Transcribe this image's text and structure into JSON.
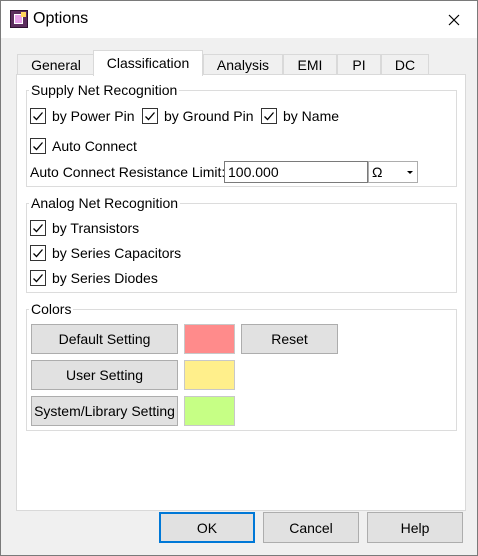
{
  "window": {
    "title": "Options"
  },
  "tabs": [
    {
      "label": "General",
      "active": false
    },
    {
      "label": "Classification",
      "active": true
    },
    {
      "label": "Analysis",
      "active": false
    },
    {
      "label": "EMI",
      "active": false
    },
    {
      "label": "PI",
      "active": false
    },
    {
      "label": "DC",
      "active": false
    }
  ],
  "supply": {
    "title": "Supply Net Recognition",
    "power_pin": {
      "label": "by Power Pin",
      "checked": true
    },
    "ground_pin": {
      "label": "by Ground Pin",
      "checked": true
    },
    "by_name": {
      "label": "by Name",
      "checked": true
    },
    "auto_connect": {
      "label": "Auto Connect",
      "checked": true
    },
    "limit_label": "Auto Connect Resistance Limit:",
    "limit_value": "100.000",
    "unit": "Ω"
  },
  "analog": {
    "title": "Analog Net Recognition",
    "transistors": {
      "label": "by Transistors",
      "checked": true
    },
    "capacitors": {
      "label": "by Series Capacitors",
      "checked": true
    },
    "diodes": {
      "label": "by Series Diodes",
      "checked": true
    }
  },
  "colors": {
    "title": "Colors",
    "default_label": "Default Setting",
    "default_color": "#ff8b8b",
    "reset_label": "Reset",
    "user_label": "User Setting",
    "user_color": "#ffef8b",
    "system_label": "System/Library Setting",
    "system_color": "#c6ff85"
  },
  "footer": {
    "ok": "OK",
    "cancel": "Cancel",
    "help": "Help"
  }
}
